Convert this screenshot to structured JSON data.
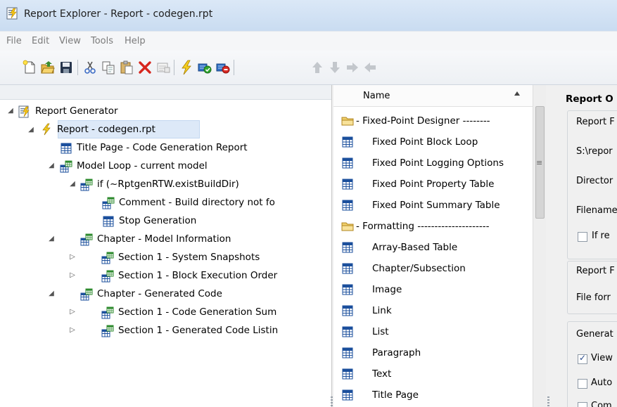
{
  "window": {
    "title": "Report Explorer - Report - codegen.rpt"
  },
  "menu": [
    "File",
    "Edit",
    "View",
    "Tools",
    "Help"
  ],
  "toolbar": [
    "new-document-icon",
    "open-folder-icon",
    "save-icon",
    "cut-icon",
    "copy-icon",
    "paste-icon",
    "delete-icon",
    "properties-icon",
    "generate-report-icon",
    "activate-component-icon",
    "deactivate-component-icon",
    "move-up-icon",
    "move-down-icon",
    "move-right-icon",
    "move-left-icon"
  ],
  "tree": [
    {
      "label": "Report Generator",
      "expander": "◢",
      "icon": "report-generator-icon"
    },
    {
      "label": "Report - codegen.rpt",
      "expander": "◢",
      "icon": "report-icon"
    },
    {
      "label": "Title Page - Code Generation Report",
      "expander": "",
      "icon": "component-icon"
    },
    {
      "label": "Model Loop - current model",
      "expander": "◢",
      "icon": "loop-component-icon"
    },
    {
      "label": "if (~RptgenRTW.existBuildDir)",
      "expander": "◢",
      "icon": "loop-component-icon"
    },
    {
      "label": "Comment - Build directory not fo",
      "expander": "",
      "icon": "loop-component-icon"
    },
    {
      "label": "Stop Generation",
      "expander": "",
      "icon": "component-icon"
    },
    {
      "label": "Chapter - Model Information",
      "expander": "◢",
      "icon": "loop-component-icon"
    },
    {
      "label": "Section 1 - System Snapshots",
      "expander": "▷",
      "icon": "loop-component-icon"
    },
    {
      "label": "Section 1 - Block Execution Order",
      "expander": "▷",
      "icon": "loop-component-icon"
    },
    {
      "label": "Chapter - Generated Code",
      "expander": "◢",
      "icon": "loop-component-icon"
    },
    {
      "label": "Section 1 - Code Generation Sum",
      "expander": "▷",
      "icon": "loop-component-icon"
    },
    {
      "label": "Section 1 - Generated Code Listin",
      "expander": "▷",
      "icon": "loop-component-icon"
    }
  ],
  "library": {
    "header": "Name",
    "rows": [
      {
        "type": "group",
        "label": "- Fixed-Point Designer --------"
      },
      {
        "type": "item",
        "label": "Fixed Point Block Loop"
      },
      {
        "type": "item",
        "label": "Fixed Point Logging Options"
      },
      {
        "type": "item",
        "label": "Fixed Point Property Table"
      },
      {
        "type": "item",
        "label": "Fixed Point Summary Table"
      },
      {
        "type": "group",
        "label": "- Formatting ---------------------"
      },
      {
        "type": "item",
        "label": "Array-Based Table"
      },
      {
        "type": "item",
        "label": "Chapter/Subsection"
      },
      {
        "type": "item",
        "label": "Image"
      },
      {
        "type": "item",
        "label": "Link"
      },
      {
        "type": "item",
        "label": "List"
      },
      {
        "type": "item",
        "label": "Paragraph"
      },
      {
        "type": "item",
        "label": "Text"
      },
      {
        "type": "item",
        "label": "Title Page"
      }
    ]
  },
  "properties": {
    "heading": "Report O",
    "group1_label": "Report F",
    "path_value": "S:\\repor",
    "directory_label": "Director",
    "filename_label": "Filename",
    "if_checkbox_label": "If re",
    "group2_label": "Report F",
    "file_format_label": "File forr",
    "group3_label": "Generat",
    "view_checkbox_label": "View",
    "auto_checkbox_label": "Auto",
    "comp_checkbox_label": "Com",
    "view_checked": true,
    "auto_checked": false,
    "comp_checked": false,
    "if_checked": false
  }
}
